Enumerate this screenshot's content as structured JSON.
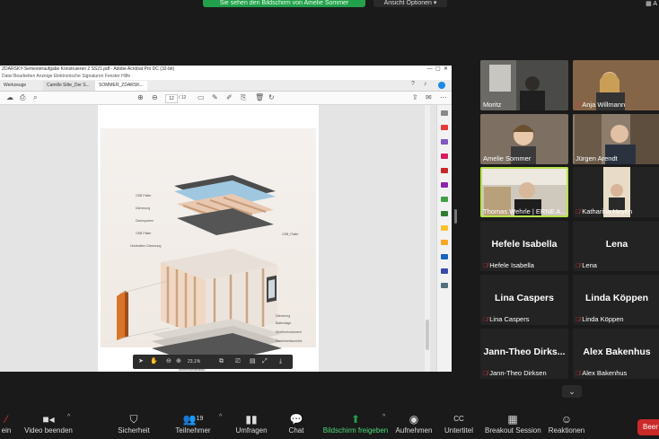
{
  "share_banner": "Sie sehen den Bildschirm von Amelie Sommer",
  "view_options": "Ansicht Optionen",
  "gallery_label": "A",
  "acrobat": {
    "title": "ZDARSKY-Semesteraufgabe Konstruieren 2 SS21.pdf - Adobe Acrobat Pro DC (32-bit)",
    "menu": "Datei  Bearbeiten  Anzeige  Elektronische Signaturen  Fenster  Hilfe",
    "tabs": [
      "Werkzeuge",
      "Camillo Sitte_Der S...",
      "SOMMER_ZDARSK..."
    ],
    "page_current": "12",
    "page_total": "/ 12",
    "zoom": "23,1%"
  },
  "drawing_labels": {
    "a": "OSB Platte",
    "b": "Dämmung",
    "c": "Dachsparren",
    "d": "OSB Platte",
    "e": "Holzbalken  Dämmung",
    "f": "OSB_Platte",
    "g": "Dämmung",
    "h": "Balkenlage",
    "i": "Streifenfundament",
    "j": "Sauberkeitsschicht",
    "k": "Außenwandaufbau"
  },
  "participants": [
    {
      "name": "Moritz",
      "muted": false,
      "type": "video"
    },
    {
      "name": "Anja Willmann",
      "muted": true,
      "type": "video"
    },
    {
      "name": "Amelie Sommer",
      "muted": false,
      "type": "video"
    },
    {
      "name": "Jürgen Arendt",
      "muted": false,
      "type": "video"
    },
    {
      "name": "Thomas Wehrle | ERNE A...",
      "muted": false,
      "type": "video",
      "active": true
    },
    {
      "name": "Katharina Heyen",
      "muted": true,
      "type": "video"
    },
    {
      "big": "Hefele Isabella",
      "name": "Hefele Isabella",
      "muted": true,
      "type": "name"
    },
    {
      "big": "Lena",
      "name": "Lena",
      "muted": true,
      "type": "name"
    },
    {
      "big": "Lina Caspers",
      "name": "Lina Caspers",
      "muted": true,
      "type": "name"
    },
    {
      "big": "Linda Köppen",
      "name": "Linda Köppen",
      "muted": true,
      "type": "name"
    },
    {
      "big": "Jann-Theo  Dirks...",
      "name": "Jann-Theo Dirksen",
      "muted": true,
      "type": "name"
    },
    {
      "big": "Alex Bakenhus",
      "name": "Alex Bakenhus",
      "muted": true,
      "type": "name"
    }
  ],
  "toolbar": {
    "mute": "ein",
    "video": "Video beenden",
    "security": "Sicherheit",
    "participants": "Teilnehmer",
    "participants_count": "19",
    "polls": "Umfragen",
    "chat": "Chat",
    "share": "Bildschirm freigeben",
    "record": "Aufnehmen",
    "captions": "Untertitel",
    "cc_icon": "CC",
    "breakout": "Breakout Session",
    "reactions": "Reaktionen",
    "leave": "Beer"
  },
  "colors": {
    "share_green": "#23a04c",
    "active_speaker": "#b6e34a",
    "muted_red": "#e0323a",
    "leave_red": "#c92a2a"
  }
}
